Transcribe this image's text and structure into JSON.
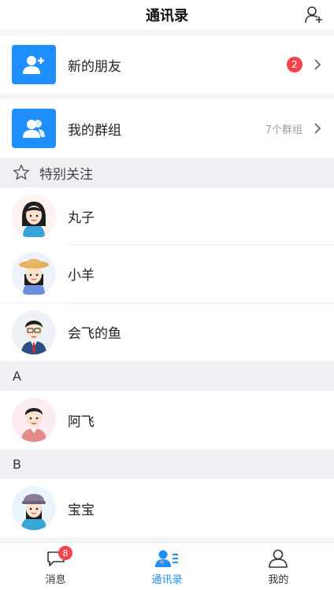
{
  "header": {
    "title": "通讯录"
  },
  "entries": {
    "new_friends": {
      "label": "新的朋友",
      "badge": "2"
    },
    "my_groups": {
      "label": "我的群组",
      "count": "7个群组"
    }
  },
  "special": {
    "title": "特别关注"
  },
  "contacts_special": [
    {
      "name": "丸子"
    },
    {
      "name": "小羊"
    },
    {
      "name": "会飞的鱼"
    }
  ],
  "sections": [
    {
      "letter": "A",
      "contacts": [
        {
          "name": "阿飞"
        }
      ]
    },
    {
      "letter": "B",
      "contacts": [
        {
          "name": "宝宝"
        }
      ]
    }
  ],
  "tabbar": {
    "items": [
      {
        "label": "消息",
        "badge": "8"
      },
      {
        "label": "通讯录"
      },
      {
        "label": "我的"
      }
    ],
    "active_color": "#1f8fff"
  },
  "colors": {
    "accent": "#1f8fff",
    "badge": "#f2454e"
  }
}
